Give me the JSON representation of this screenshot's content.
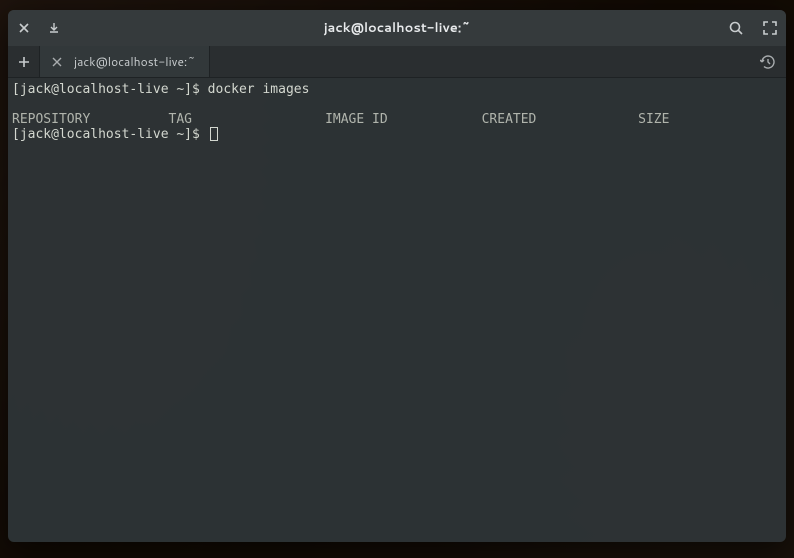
{
  "titlebar": {
    "title": "jack@localhost-live:~"
  },
  "tabs": [
    {
      "label": "jack@localhost-live:~"
    }
  ],
  "terminal": {
    "prompt1": "[jack@localhost-live ~]$ ",
    "command1": "docker images",
    "output_header": "REPOSITORY          TAG                 IMAGE ID            CREATED             SIZE",
    "prompt2": "[jack@localhost-live ~]$ "
  }
}
